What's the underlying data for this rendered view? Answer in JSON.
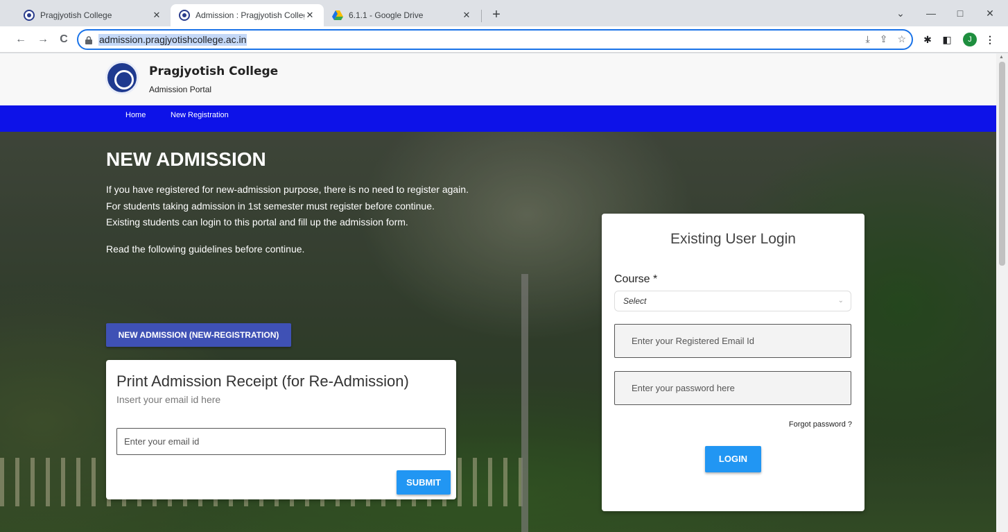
{
  "browser": {
    "tabs": [
      {
        "title": "Pragjyotish College",
        "active": false
      },
      {
        "title": "Admission : Pragjyotish College",
        "active": true
      },
      {
        "title": "6.1.1 - Google Drive",
        "active": false
      }
    ],
    "url": "admission.pragjyotishcollege.ac.in",
    "profile_initial": "J",
    "icons": {
      "back": "←",
      "forward": "→",
      "reload": "C",
      "minimize": "—",
      "maximize": "□",
      "close": "✕",
      "dropdown": "⌄",
      "new_tab": "+",
      "tab_close": "✕",
      "install": "⤓",
      "share": "⇪",
      "star": "☆",
      "extensions": "✱",
      "sidepanel": "◧",
      "menu": "⋮"
    }
  },
  "site": {
    "name": "Pragjyotish College",
    "subtitle": "Admission Portal",
    "nav": [
      "Home",
      "New Registration"
    ],
    "colors": {
      "nav": "#0d12e8",
      "button_primary": "#3f51b5",
      "button_action": "#2196f3"
    }
  },
  "hero": {
    "title": "NEW ADMISSION",
    "lines": [
      "If you have registered for new-admission purpose, there is no need to register again.",
      "For students taking admission in 1st semester must register before continue.",
      "Existing students can login to this portal and fill up the admission form.",
      "Read the following guidelines before continue."
    ],
    "button": "NEW ADMISSION (NEW-REGISTRATION)"
  },
  "receipt": {
    "title": "Print Admission Receipt (for Re-Admission)",
    "subtitle": "Insert your email id here",
    "email_placeholder": "Enter your email id",
    "submit": "SUBMIT"
  },
  "login": {
    "title": "Existing User Login",
    "course_label": "Course *",
    "course_value": "Select",
    "email_placeholder": "Enter your Registered Email Id",
    "password_placeholder": "Enter your password here",
    "forgot": "Forgot password ?",
    "button": "LOGIN"
  }
}
